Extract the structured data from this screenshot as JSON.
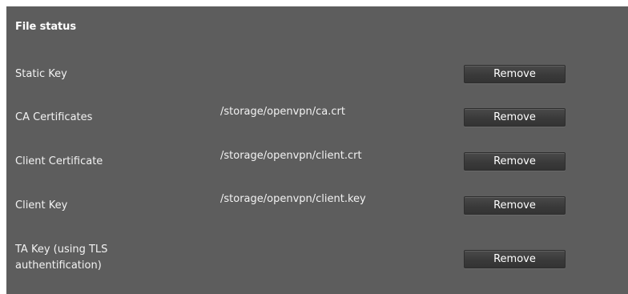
{
  "section": {
    "title": "File status"
  },
  "rows": [
    {
      "label": "Static Key",
      "path": "",
      "button": "Remove"
    },
    {
      "label": "CA Certificates",
      "path": "/storage/openvpn/ca.crt",
      "button": "Remove"
    },
    {
      "label": "Client Certificate",
      "path": "/storage/openvpn/client.crt",
      "button": "Remove"
    },
    {
      "label": "Client Key",
      "path": "/storage/openvpn/client.key",
      "button": "Remove"
    },
    {
      "label_line1": "TA Key (using TLS",
      "label_line2": "authentification)",
      "path": "",
      "button": "Remove"
    }
  ],
  "colors": {
    "panel_background": "#5d5d5d",
    "button_background": "#3a3a3a",
    "text": "#ffffff"
  }
}
